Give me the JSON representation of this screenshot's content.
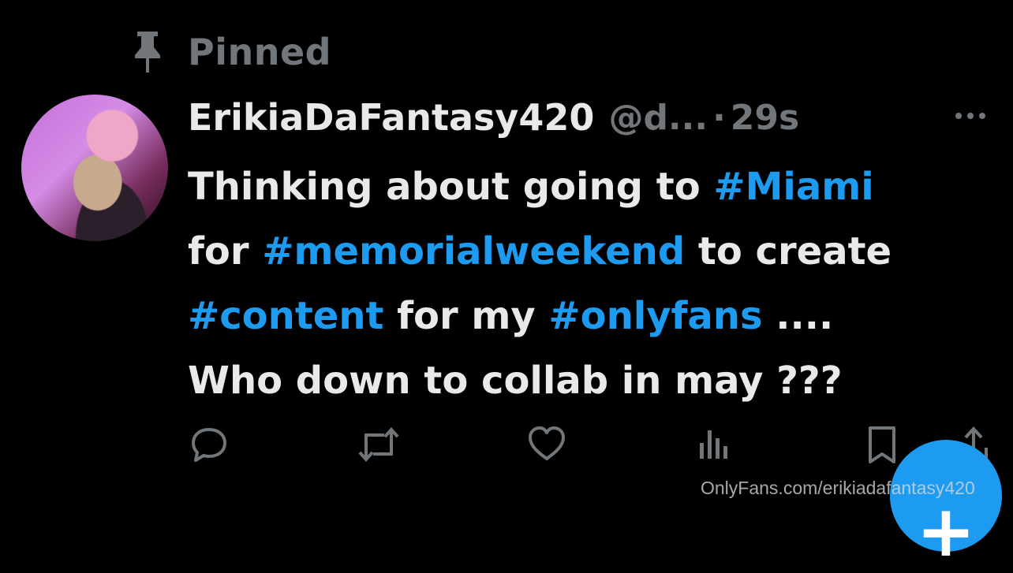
{
  "pinned": {
    "label": "Pinned",
    "icon": "pin-icon"
  },
  "tweet": {
    "display_name": "ErikiaDaFantasy420",
    "handle": "@d...",
    "separator": "·",
    "time": "29s",
    "text_lines": [
      [
        {
          "text": "Thinking about going to ",
          "hashtag": false
        },
        {
          "text": "#Miami",
          "hashtag": true
        }
      ],
      [
        {
          "text": "for ",
          "hashtag": false
        },
        {
          "text": "#memorialweekend",
          "hashtag": true
        },
        {
          "text": "  to create",
          "hashtag": false
        }
      ],
      [
        {
          "text": "#content",
          "hashtag": true
        },
        {
          "text": " for my ",
          "hashtag": false
        },
        {
          "text": "#onlyfans",
          "hashtag": true
        },
        {
          "text": " ....",
          "hashtag": false
        }
      ],
      [
        {
          "text": "Who down to collab in may ???",
          "hashtag": false
        }
      ]
    ]
  },
  "actions": [
    "reply-icon",
    "retweet-icon",
    "like-icon",
    "views-icon",
    "bookmark-icon",
    "share-icon"
  ],
  "compose_button": {
    "label": "+"
  },
  "watermark": "OnlyFans.com/erikiadafantasy420",
  "colors": {
    "background": "#000000",
    "text": "#e7e9ea",
    "muted": "#71767b",
    "accent": "#1d9bf0"
  }
}
